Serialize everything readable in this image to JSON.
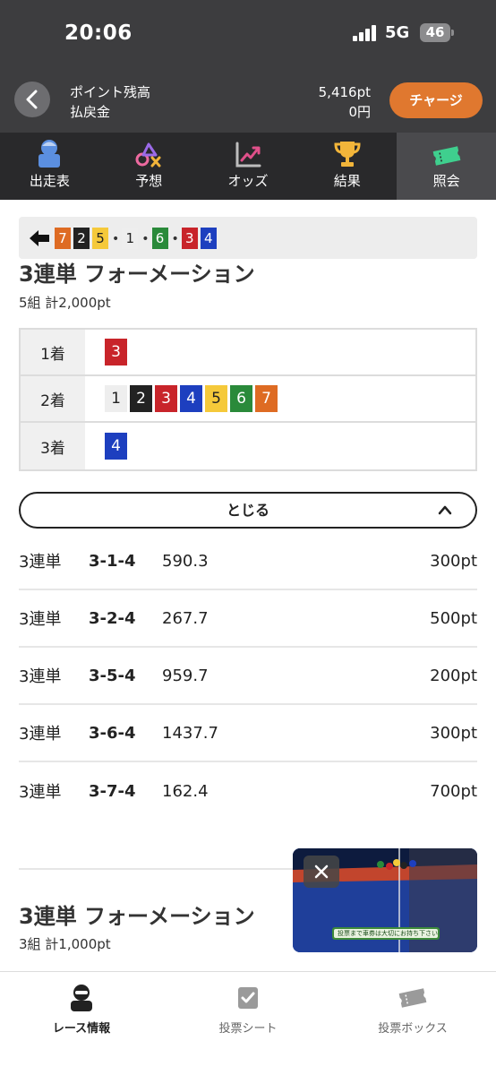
{
  "status_bar": {
    "time": "20:06",
    "network": "5G",
    "battery": "46"
  },
  "header": {
    "labels": [
      "ポイント残高",
      "払戻金"
    ],
    "values": [
      "5,416pt",
      "0円"
    ],
    "charge_label": "チャージ"
  },
  "tabs": [
    {
      "label": "出走表",
      "icon": "runner-list-icon",
      "active": false
    },
    {
      "label": "予想",
      "icon": "prediction-shapes-icon",
      "active": false
    },
    {
      "label": "オッズ",
      "icon": "chart-trend-icon",
      "active": false
    },
    {
      "label": "結果",
      "icon": "trophy-icon",
      "active": false
    },
    {
      "label": "照会",
      "icon": "ticket-icon",
      "active": true
    }
  ],
  "combo_bar": {
    "groups": [
      [
        "7",
        "2",
        "5"
      ],
      [
        "1"
      ],
      [
        "6"
      ],
      [
        "3",
        "4"
      ]
    ]
  },
  "section1": {
    "title": "3連単 フォーメーション",
    "subtitle": "5組 計2,000pt",
    "rows": [
      {
        "position": "1着",
        "numbers": [
          "3"
        ]
      },
      {
        "position": "2着",
        "numbers": [
          "1",
          "2",
          "3",
          "4",
          "5",
          "6",
          "7"
        ]
      },
      {
        "position": "3着",
        "numbers": [
          "4"
        ]
      }
    ],
    "close_label": "とじる"
  },
  "bets": [
    {
      "type": "3連単",
      "combo": "3-1-4",
      "odds": "590.3",
      "amount": "300pt"
    },
    {
      "type": "3連単",
      "combo": "3-2-4",
      "odds": "267.7",
      "amount": "500pt"
    },
    {
      "type": "3連単",
      "combo": "3-5-4",
      "odds": "959.7",
      "amount": "200pt"
    },
    {
      "type": "3連単",
      "combo": "3-6-4",
      "odds": "1437.7",
      "amount": "300pt"
    },
    {
      "type": "3連単",
      "combo": "3-7-4",
      "odds": "162.4",
      "amount": "700pt"
    }
  ],
  "section2": {
    "title": "3連単 フォーメーション",
    "subtitle": "3組 計1,000pt"
  },
  "video": {
    "caption": "投票まで車券は大切にお持ち下さい"
  },
  "bottom_nav": [
    {
      "label": "レース情報",
      "icon": "race-info-icon",
      "active": true
    },
    {
      "label": "投票シート",
      "icon": "vote-sheet-icon",
      "active": false
    },
    {
      "label": "投票ボックス",
      "icon": "vote-box-icon",
      "active": false
    }
  ],
  "number_colors": {
    "1": {
      "bg": "#eeeeee",
      "fg": "#222222"
    },
    "2": {
      "bg": "#222222",
      "fg": "#ffffff"
    },
    "3": {
      "bg": "#c8242a",
      "fg": "#ffffff"
    },
    "4": {
      "bg": "#1d3fbf",
      "fg": "#ffffff"
    },
    "5": {
      "bg": "#f5c93a",
      "fg": "#222222"
    },
    "6": {
      "bg": "#2a8a3a",
      "fg": "#ffffff"
    },
    "7": {
      "bg": "#de6b23",
      "fg": "#ffffff"
    }
  },
  "colors": {
    "accent": "#e0782f",
    "header_bg": "#3d3d3f",
    "tab_bg": "#29292b"
  }
}
